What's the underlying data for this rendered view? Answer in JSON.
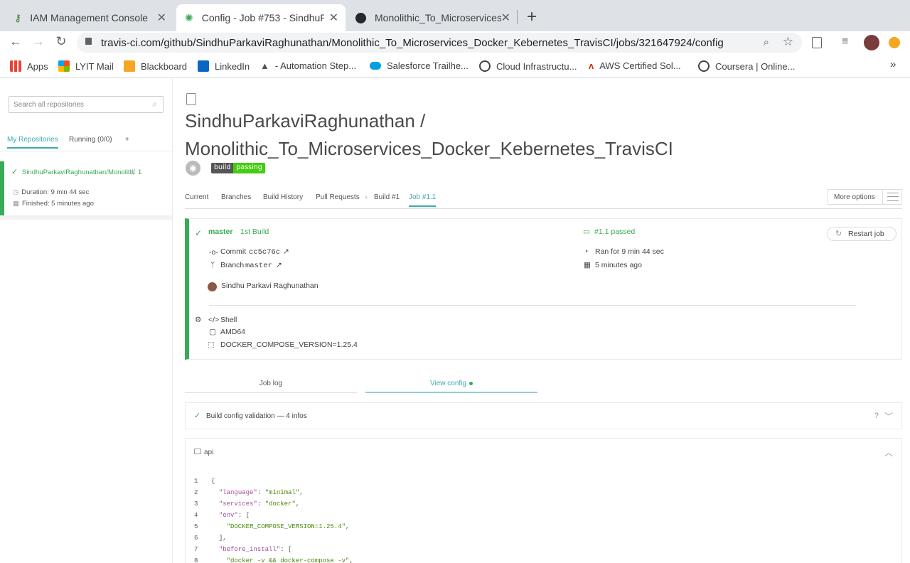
{
  "browser": {
    "tabs": [
      {
        "title": "IAM Management Console",
        "active": false
      },
      {
        "title": "Config - Job #753 - SindhuParkavi",
        "active": true
      },
      {
        "title": "Monolithic_To_Microservices_Docker",
        "active": false
      }
    ],
    "url": "travis-ci.com/github/SindhuParkaviRaghunathan/Monolithic_To_Microservices_Docker_Kebernetes_TravisCI/jobs/321647924/config",
    "bookmarks": [
      {
        "label": "Apps",
        "color": "#4285f4"
      },
      {
        "label": "LYIT Mail",
        "color": "#f25022"
      },
      {
        "label": "Blackboard",
        "color": "#f5a623"
      },
      {
        "label": "LinkedIn",
        "color": "#0a66c2"
      },
      {
        "label": "- Automation Step...",
        "color": "#555555"
      },
      {
        "label": "Salesforce Trailhe...",
        "color": "#00a1e0"
      },
      {
        "label": "Cloud Infrastructu...",
        "color": "#444444"
      },
      {
        "label": "AWS Certified Sol...",
        "color": "#d13212"
      },
      {
        "label": "Coursera | Online...",
        "color": "#444444"
      }
    ],
    "overflow_label": "»"
  },
  "sidebar": {
    "search_placeholder": "Search all repositories",
    "tabs": [
      "My Repositories",
      "Running (0/0)",
      "+"
    ],
    "repo": {
      "name": "SindhuParkaviRaghunathan/Monolithic_To_Microservices",
      "build_number": "1",
      "duration": "Duration: 9 min 44 sec",
      "finished": "Finished: 5 minutes ago"
    }
  },
  "main": {
    "owner": "SindhuParkaviRaghunathan /",
    "repo": "Monolithic_To_Microservices_Docker_Kebernetes_TravisCI",
    "badge": {
      "left": "build",
      "right": "passing"
    },
    "nav": [
      "Current",
      "Branches",
      "Build History",
      "Pull Requests",
      "Build #1",
      "Job #1.1"
    ],
    "more_options": "More options",
    "job": {
      "branch": "master",
      "build_label": "1st Build",
      "commit_label": "Commit",
      "commit_hash": "cc5c76c",
      "branch_label": "Branch",
      "branch_value": "master",
      "author": "Sindhu Parkavi Raghunathan",
      "status": "#1.1 passed",
      "ran_for": "Ran for 9 min 44 sec",
      "ago": "5 minutes ago",
      "restart": "Restart job",
      "language": "Shell",
      "arch": "AMD64",
      "env": "DOCKER_COMPOSE_VERSION=1.25.4"
    },
    "log_tabs": [
      "Job log",
      "View config"
    ],
    "validation": "Build config validation — 4 infos",
    "validation_help": "?",
    "config_title": "api",
    "code_lines": [
      {
        "n": "1",
        "t": "{"
      },
      {
        "n": "2",
        "k": "\"language\"",
        "s": "\"minimal\""
      },
      {
        "n": "3",
        "k": "\"services\"",
        "s": "\"docker\""
      },
      {
        "n": "4",
        "k": "\"env\"",
        "t": ": ["
      },
      {
        "n": "5",
        "s": "\"DOCKER_COMPOSE_VERSION=1.25.4\""
      },
      {
        "n": "6",
        "t": "],"
      },
      {
        "n": "7",
        "k": "\"before_install\"",
        "t": ": ["
      },
      {
        "n": "8",
        "s": "\"docker -v && docker-compose -v\""
      }
    ]
  },
  "colors": {
    "passed": "#39aa56",
    "accent": "#3eaaaf"
  }
}
